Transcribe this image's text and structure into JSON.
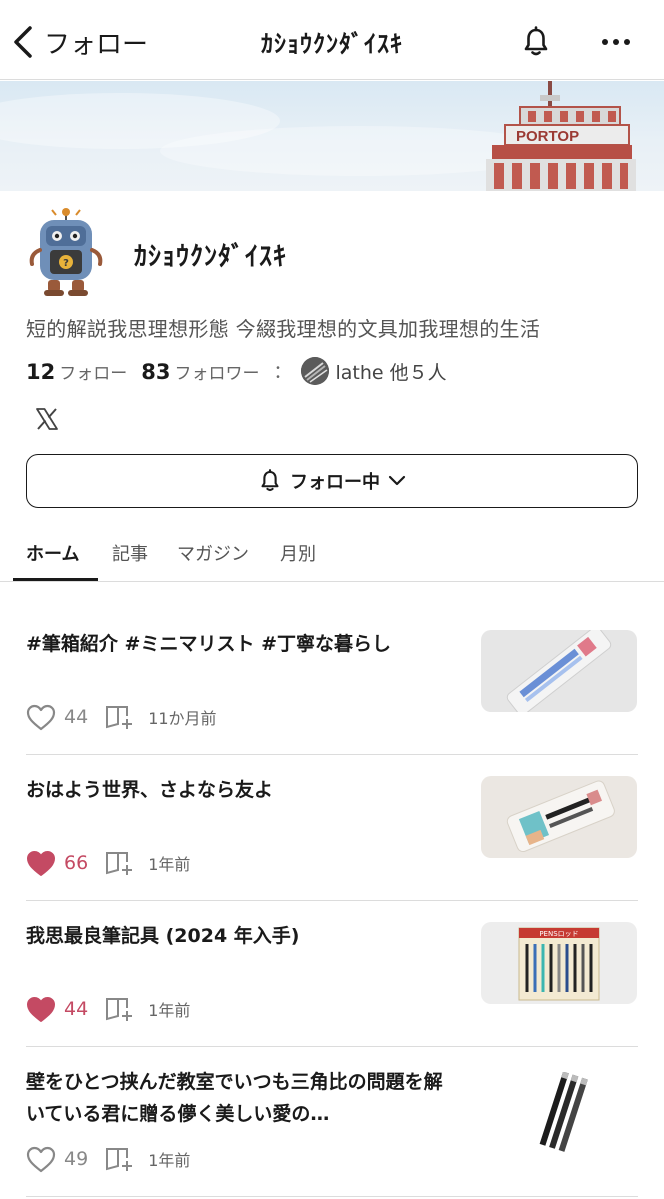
{
  "header": {
    "back_label": "フォロー",
    "title": "ｶｼｮｳｸﾝﾀﾞｲｽｷ"
  },
  "profile": {
    "name": "ｶｼｮｳｸﾝﾀﾞｲｽｷ",
    "bio": "短的解説我思理想形態 今綴我理想的文具加我理想的生活",
    "following_count": "12",
    "following_label": "フォロー",
    "followers_count": "83",
    "followers_label": "フォロワー",
    "colon": "：",
    "mutual_text": "lathe 他５人",
    "follow_button_label": "フォロー中"
  },
  "tabs": [
    {
      "label": "ホーム",
      "active": true
    },
    {
      "label": "記事",
      "active": false
    },
    {
      "label": "マガジン",
      "active": false
    },
    {
      "label": "月別",
      "active": false
    }
  ],
  "articles": [
    {
      "title": "#筆箱紹介 #ミニマリスト #丁寧な暮らし",
      "likes": "44",
      "liked": false,
      "time": "11か月前"
    },
    {
      "title": "おはよう世界、さよなら友よ",
      "likes": "66",
      "liked": true,
      "time": "1年前"
    },
    {
      "title": "我思最良筆記具 (2024 年入手)",
      "likes": "44",
      "liked": true,
      "time": "1年前"
    },
    {
      "title": "壁をひとつ挟んだ教室でいつも三角比の問題を解いている君に贈る儚く美しい愛の…",
      "likes": "49",
      "liked": false,
      "time": "1年前"
    }
  ],
  "banner": {
    "tower_text": "PORTOP"
  },
  "thumb3_label": "PENSロッド",
  "colors": {
    "accent_like": "#c44a63",
    "text": "#1a1a1a",
    "muted": "#666666",
    "divider": "#dcdcdc"
  },
  "icons": {
    "back": "chevron-left-icon",
    "bell": "bell-icon",
    "more": "more-icon",
    "x": "x-logo-icon",
    "heart": "heart-icon",
    "save": "magazine-add-icon",
    "chevron": "chevron-down-icon"
  }
}
